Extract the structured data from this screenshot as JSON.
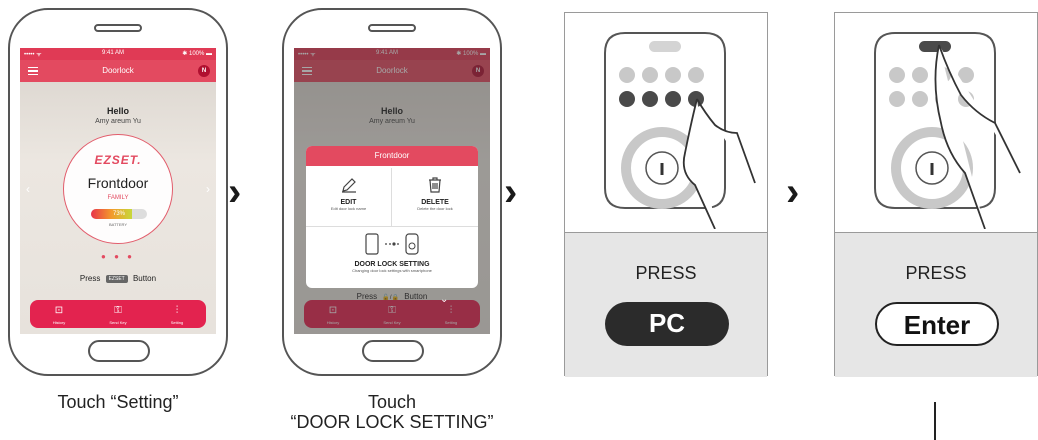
{
  "steps": [
    {
      "caption": "Touch “Setting”",
      "phone": {
        "status_left": "••••• ᯤ",
        "status_time": "9:41 AM",
        "status_right": "✱ 100% ▬",
        "app_title": "Doorlock",
        "avatar_letter": "N",
        "greeting": "Hello",
        "user_name": "Amy areum Yu",
        "logo": "EZSET.",
        "lock_name": "Frontdoor",
        "lock_group": "FAMILY",
        "battery_percent": 73,
        "battery_text": "73%",
        "battery_label": "BATTERY",
        "pager_dots": "● ● ●",
        "press_prefix": "Press",
        "press_badge": "EZSET",
        "press_suffix": "Button",
        "tabs": [
          {
            "label": "History",
            "icon": "history-icon"
          },
          {
            "label": "Send Key",
            "icon": "send-key-icon"
          },
          {
            "label": "Setting",
            "icon": "setting-icon"
          }
        ]
      }
    },
    {
      "caption_line1": "Touch",
      "caption_line2": "“DOOR LOCK SETTING”",
      "dialog": {
        "title": "Frontdoor",
        "edit_title": "EDIT",
        "edit_sub": "Edit door lock name",
        "delete_title": "DELETE",
        "delete_sub": "Delete the door lock",
        "setting_title": "DOOR LOCK SETTING",
        "setting_sub": "Changing door lock settings with smartphone"
      },
      "press_prefix": "Press",
      "press_suffix": "Button"
    },
    {
      "press_label": "PRESS",
      "key_label": "PC"
    },
    {
      "press_label": "PRESS",
      "key_label": "Enter"
    }
  ],
  "colors": {
    "brand": "#e34a60",
    "tabbar": "#e3234f",
    "key_dark": "#2b2b2b"
  }
}
